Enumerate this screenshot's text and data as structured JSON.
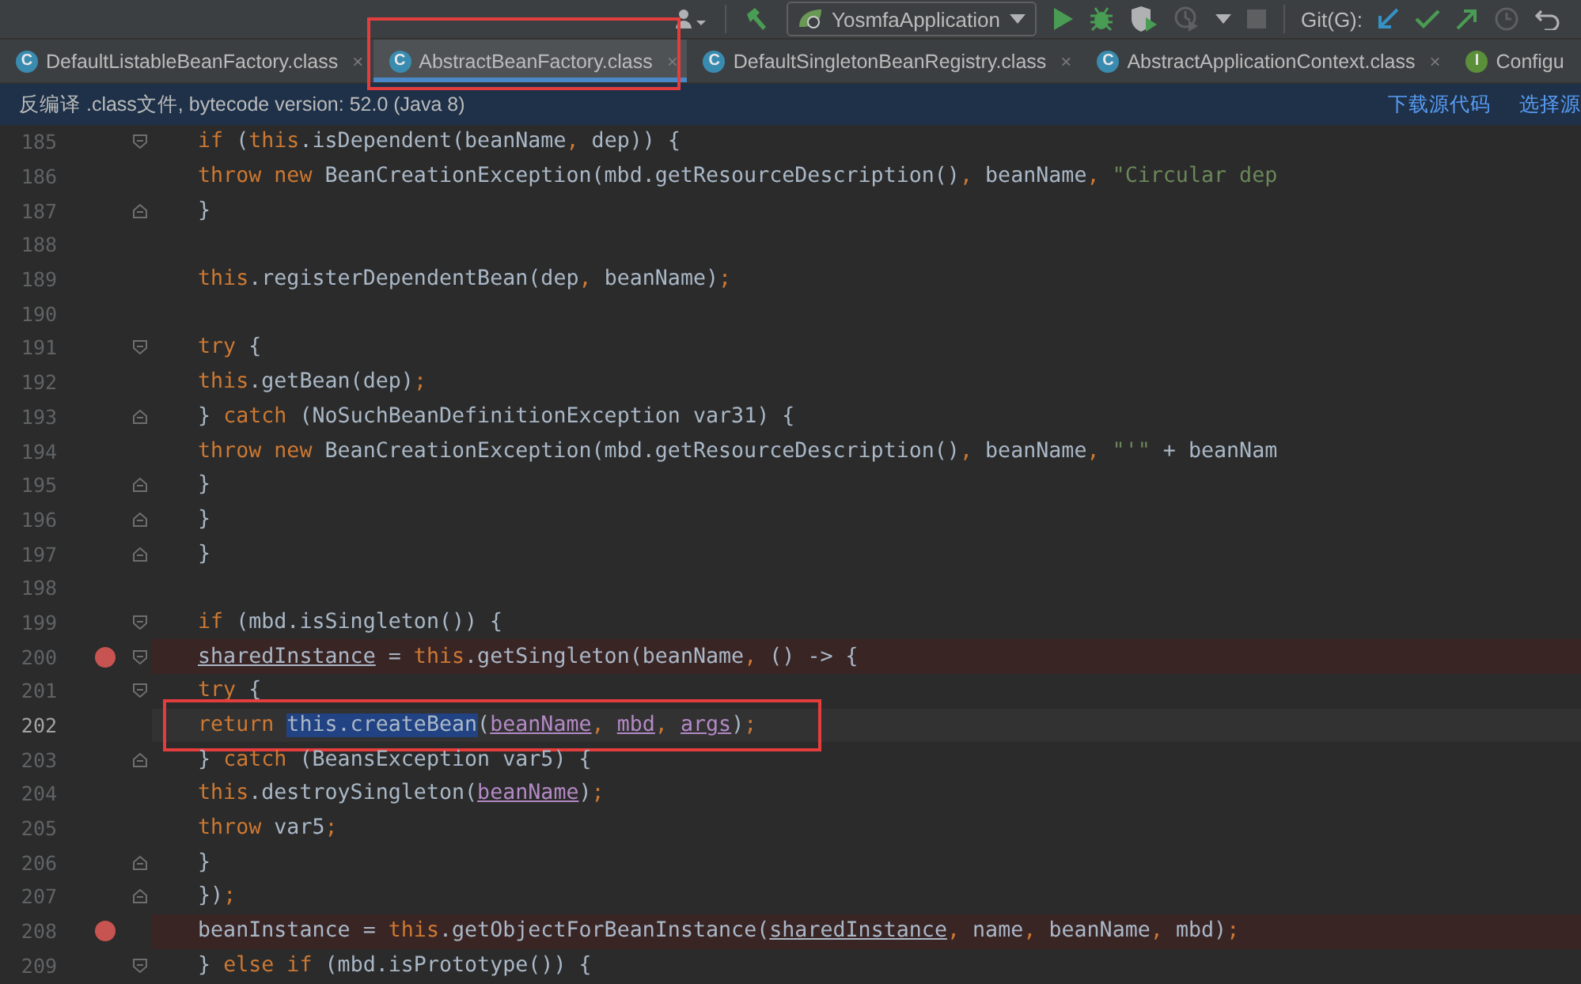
{
  "toolbar": {
    "run_config": "YosmfaApplication",
    "git_label": "Git(G):"
  },
  "tabs": [
    {
      "label": "DefaultListableBeanFactory.class",
      "badge": "C",
      "kind": "class",
      "selected": false,
      "close": "×",
      "highlighted": false
    },
    {
      "label": "AbstractBeanFactory.class",
      "badge": "C",
      "kind": "class",
      "selected": true,
      "close": "×",
      "highlighted": true
    },
    {
      "label": "DefaultSingletonBeanRegistry.class",
      "badge": "C",
      "kind": "class",
      "selected": false,
      "close": "×",
      "highlighted": false
    },
    {
      "label": "AbstractApplicationContext.class",
      "badge": "C",
      "kind": "class",
      "selected": false,
      "close": "×",
      "highlighted": false
    },
    {
      "label": "Configu",
      "badge": "I",
      "kind": "interface",
      "selected": false,
      "highlighted": false
    }
  ],
  "banner": {
    "message": "反编译 .class文件, bytecode version: 52.0 (Java 8)",
    "links": [
      "下载源代码",
      "选择源"
    ]
  },
  "editor": {
    "lines": [
      {
        "number": "185",
        "fold_open": true,
        "fold_close": false,
        "breakpoint": false,
        "current": false,
        "highlighted": false,
        "tokens": [
          {
            "kind": "kw",
            "text": "                    if "
          },
          {
            "kind": "plain",
            "text": "("
          },
          {
            "kind": "kw",
            "text": "this"
          },
          {
            "kind": "plain",
            "text": ".isDependent(beanName"
          },
          {
            "kind": "kw",
            "text": ", "
          },
          {
            "kind": "plain",
            "text": "dep)) {"
          }
        ]
      },
      {
        "number": "186",
        "fold_open": false,
        "fold_close": false,
        "breakpoint": false,
        "current": false,
        "highlighted": false,
        "tokens": [
          {
            "kind": "kw",
            "text": "                        throw new "
          },
          {
            "kind": "plain",
            "text": "BeanCreationException(mbd.getResourceDescription()"
          },
          {
            "kind": "kw",
            "text": ", "
          },
          {
            "kind": "plain",
            "text": "beanName"
          },
          {
            "kind": "kw",
            "text": ", "
          },
          {
            "kind": "str",
            "text": "\"Circular dep"
          }
        ]
      },
      {
        "number": "187",
        "fold_open": false,
        "fold_close": true,
        "breakpoint": false,
        "current": false,
        "highlighted": false,
        "tokens": [
          {
            "kind": "plain",
            "text": "                    }"
          }
        ]
      },
      {
        "number": "188",
        "fold_open": false,
        "fold_close": false,
        "breakpoint": false,
        "current": false,
        "highlighted": false
      },
      {
        "number": "189",
        "fold_open": false,
        "fold_close": false,
        "breakpoint": false,
        "current": false,
        "highlighted": false,
        "tokens": [
          {
            "kind": "kw",
            "text": "                    this"
          },
          {
            "kind": "plain",
            "text": ".registerDependentBean(dep"
          },
          {
            "kind": "kw",
            "text": ", "
          },
          {
            "kind": "plain",
            "text": "beanName)"
          },
          {
            "kind": "kw",
            "text": ";"
          }
        ]
      },
      {
        "number": "190",
        "fold_open": false,
        "fold_close": false,
        "breakpoint": false,
        "current": false,
        "highlighted": false
      },
      {
        "number": "191",
        "fold_open": true,
        "fold_close": false,
        "breakpoint": false,
        "current": false,
        "highlighted": false,
        "tokens": [
          {
            "kind": "kw",
            "text": "                    try "
          },
          {
            "kind": "plain",
            "text": "{"
          }
        ]
      },
      {
        "number": "192",
        "fold_open": false,
        "fold_close": false,
        "breakpoint": false,
        "current": false,
        "highlighted": false,
        "tokens": [
          {
            "kind": "kw",
            "text": "                        this"
          },
          {
            "kind": "plain",
            "text": ".getBean(dep)"
          },
          {
            "kind": "kw",
            "text": ";"
          }
        ]
      },
      {
        "number": "193",
        "fold_open": false,
        "fold_close": true,
        "breakpoint": false,
        "current": false,
        "highlighted": false,
        "tokens": [
          {
            "kind": "plain",
            "text": "                    } "
          },
          {
            "kind": "kw",
            "text": "catch "
          },
          {
            "kind": "plain",
            "text": "(NoSuchBeanDefinitionException var31) {"
          }
        ]
      },
      {
        "number": "194",
        "fold_open": false,
        "fold_close": false,
        "breakpoint": false,
        "current": false,
        "highlighted": false,
        "tokens": [
          {
            "kind": "kw",
            "text": "                        throw new "
          },
          {
            "kind": "plain",
            "text": "BeanCreationException(mbd.getResourceDescription()"
          },
          {
            "kind": "kw",
            "text": ", "
          },
          {
            "kind": "plain",
            "text": "beanName"
          },
          {
            "kind": "kw",
            "text": ", "
          },
          {
            "kind": "str",
            "text": "\"'\" "
          },
          {
            "kind": "plain",
            "text": "+ beanNam"
          }
        ]
      },
      {
        "number": "195",
        "fold_open": false,
        "fold_close": true,
        "breakpoint": false,
        "current": false,
        "highlighted": false,
        "tokens": [
          {
            "kind": "plain",
            "text": "                    }"
          }
        ]
      },
      {
        "number": "196",
        "fold_open": false,
        "fold_close": true,
        "breakpoint": false,
        "current": false,
        "highlighted": false,
        "tokens": [
          {
            "kind": "plain",
            "text": "                }"
          }
        ]
      },
      {
        "number": "197",
        "fold_open": false,
        "fold_close": true,
        "breakpoint": false,
        "current": false,
        "highlighted": false,
        "tokens": [
          {
            "kind": "plain",
            "text": "            }"
          }
        ]
      },
      {
        "number": "198",
        "fold_open": false,
        "fold_close": false,
        "breakpoint": false,
        "current": false,
        "highlighted": false
      },
      {
        "number": "199",
        "fold_open": true,
        "fold_close": false,
        "breakpoint": false,
        "current": false,
        "highlighted": false,
        "tokens": [
          {
            "kind": "kw",
            "text": "            if "
          },
          {
            "kind": "plain",
            "text": "(mbd.isSingleton()) {"
          }
        ]
      },
      {
        "number": "200",
        "fold_open": true,
        "fold_close": false,
        "breakpoint": true,
        "current": false,
        "highlighted": false,
        "tokens": [
          {
            "kind": "var",
            "text": "                sharedInstance"
          },
          {
            "kind": "plain",
            "text": " = "
          },
          {
            "kind": "kw",
            "text": "this"
          },
          {
            "kind": "plain",
            "text": ".getSingleton(beanName"
          },
          {
            "kind": "kw",
            "text": ", "
          },
          {
            "kind": "plain",
            "text": "() -> {"
          }
        ]
      },
      {
        "number": "201",
        "fold_open": true,
        "fold_close": false,
        "breakpoint": false,
        "current": false,
        "highlighted": false,
        "tokens": [
          {
            "kind": "kw",
            "text": "                    try "
          },
          {
            "kind": "plain",
            "text": "{"
          }
        ]
      },
      {
        "number": "202",
        "fold_open": false,
        "fold_close": false,
        "breakpoint": false,
        "current": true,
        "highlighted": true,
        "tokens": [
          {
            "kind": "kw",
            "text": "                        return "
          },
          {
            "kind": "sel",
            "text": "this.createBean"
          },
          {
            "kind": "plain",
            "text": "("
          },
          {
            "kind": "param",
            "text": "beanName"
          },
          {
            "kind": "kw",
            "text": ", "
          },
          {
            "kind": "param",
            "text": "mbd"
          },
          {
            "kind": "kw",
            "text": ", "
          },
          {
            "kind": "param",
            "text": "args"
          },
          {
            "kind": "plain",
            "text": ")"
          },
          {
            "kind": "kw",
            "text": ";"
          }
        ]
      },
      {
        "number": "203",
        "fold_open": false,
        "fold_close": true,
        "breakpoint": false,
        "current": false,
        "highlighted": false,
        "tokens": [
          {
            "kind": "plain",
            "text": "                    } "
          },
          {
            "kind": "kw",
            "text": "catch "
          },
          {
            "kind": "plain",
            "text": "(BeansException var5) {"
          }
        ]
      },
      {
        "number": "204",
        "fold_open": false,
        "fold_close": false,
        "breakpoint": false,
        "current": false,
        "highlighted": false,
        "tokens": [
          {
            "kind": "kw",
            "text": "                        this"
          },
          {
            "kind": "plain",
            "text": ".destroySingleton("
          },
          {
            "kind": "param",
            "text": "beanName"
          },
          {
            "kind": "plain",
            "text": ")"
          },
          {
            "kind": "kw",
            "text": ";"
          }
        ]
      },
      {
        "number": "205",
        "fold_open": false,
        "fold_close": false,
        "breakpoint": false,
        "current": false,
        "highlighted": false,
        "tokens": [
          {
            "kind": "kw",
            "text": "                        throw "
          },
          {
            "kind": "plain",
            "text": "var5"
          },
          {
            "kind": "kw",
            "text": ";"
          }
        ]
      },
      {
        "number": "206",
        "fold_open": false,
        "fold_close": true,
        "breakpoint": false,
        "current": false,
        "highlighted": false,
        "tokens": [
          {
            "kind": "plain",
            "text": "                    }"
          }
        ]
      },
      {
        "number": "207",
        "fold_open": false,
        "fold_close": true,
        "breakpoint": false,
        "current": false,
        "highlighted": false,
        "tokens": [
          {
            "kind": "plain",
            "text": "                })"
          },
          {
            "kind": "kw",
            "text": ";"
          }
        ]
      },
      {
        "number": "208",
        "fold_open": false,
        "fold_close": false,
        "breakpoint": true,
        "current": false,
        "highlighted": false,
        "tokens": [
          {
            "kind": "plain",
            "text": "                beanInstance = "
          },
          {
            "kind": "kw",
            "text": "this"
          },
          {
            "kind": "plain",
            "text": ".getObjectForBeanInstance("
          },
          {
            "kind": "var",
            "text": "sharedInstance"
          },
          {
            "kind": "kw",
            "text": ", "
          },
          {
            "kind": "plain",
            "text": "name"
          },
          {
            "kind": "kw",
            "text": ", "
          },
          {
            "kind": "plain",
            "text": "beanName"
          },
          {
            "kind": "kw",
            "text": ", "
          },
          {
            "kind": "plain",
            "text": "mbd)"
          },
          {
            "kind": "kw",
            "text": ";"
          }
        ]
      },
      {
        "number": "209",
        "fold_open": true,
        "fold_close": false,
        "breakpoint": false,
        "current": false,
        "highlighted": false,
        "tokens": [
          {
            "kind": "plain",
            "text": "            } "
          },
          {
            "kind": "kw",
            "text": "else if "
          },
          {
            "kind": "plain",
            "text": "(mbd.isPrototype()) {"
          }
        ]
      }
    ]
  }
}
